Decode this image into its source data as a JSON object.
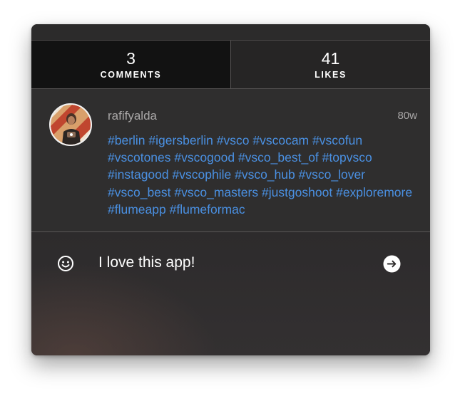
{
  "stats": {
    "comments": {
      "count": "3",
      "label": "COMMENTS"
    },
    "likes": {
      "count": "41",
      "label": "LIKES"
    }
  },
  "post": {
    "username": "rafifyalda",
    "time": "80w",
    "hashtags": [
      "#berlin",
      "#igersberlin",
      "#vsco",
      "#vscocam",
      "#vscofun",
      "#vscotones",
      "#vscogood",
      "#vsco_best_of",
      "#topvsco",
      "#instagood",
      "#vscophile",
      "#vsco_hub",
      "#vsco_lover",
      "#vsco_best",
      "#vsco_masters",
      "#justgoshoot",
      "#exploremore",
      "#flumeapp",
      "#flumeformac"
    ]
  },
  "composer": {
    "value": "I love this app!",
    "emoji_icon": "smiley-icon",
    "send_icon": "arrow-right-circle-icon"
  },
  "colors": {
    "hashtag": "#4a90e2",
    "background": "#2e2c2c"
  }
}
